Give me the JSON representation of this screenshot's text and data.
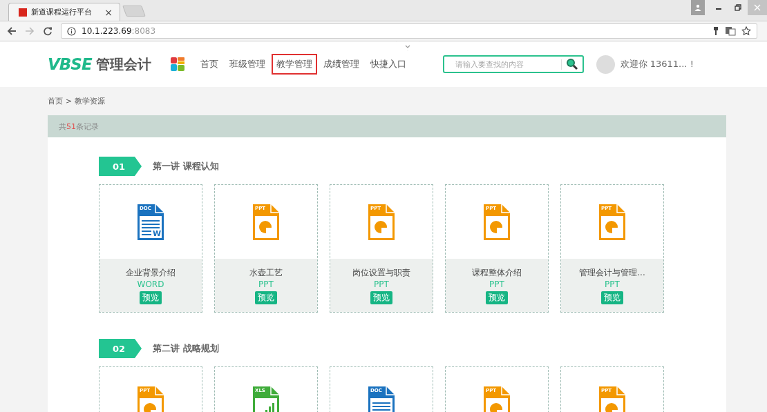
{
  "browser": {
    "tabs": [
      {
        "title": "新道课程运行平台",
        "close": "×",
        "selected": true
      }
    ],
    "address": {
      "host": "10.1.223.69",
      "port": ":8083"
    }
  },
  "header": {
    "logo": {
      "mark": "VBSE",
      "text": "管理会计"
    },
    "nav": [
      {
        "label": "首页",
        "selected": false
      },
      {
        "label": "班级管理",
        "selected": false
      },
      {
        "label": "教学管理",
        "selected": true
      },
      {
        "label": "成绩管理",
        "selected": false
      },
      {
        "label": "快捷入口",
        "selected": false
      }
    ],
    "search": {
      "placeholder": "请输入要查找的内容"
    },
    "user": {
      "greeting": "欢迎你 13611... !"
    }
  },
  "breadcrumb": {
    "home": "首页",
    "separator": ">",
    "current": "教学资源"
  },
  "records": {
    "prefix": "共",
    "count": "51",
    "suffix": "条记录"
  },
  "sections": [
    {
      "number": "01",
      "title": "第一讲 课程认知",
      "files": [
        {
          "kind": "doc",
          "badge": "DOC",
          "mark": "W",
          "name": "企业背景介绍",
          "type": "WORD",
          "action": "预览"
        },
        {
          "kind": "ppt",
          "badge": "PPT",
          "name": "水壶工艺",
          "type": "PPT",
          "action": "预览"
        },
        {
          "kind": "ppt",
          "badge": "PPT",
          "name": "岗位设置与职责",
          "type": "PPT",
          "action": "预览"
        },
        {
          "kind": "ppt",
          "badge": "PPT",
          "name": "课程整体介绍",
          "type": "PPT",
          "action": "预览"
        },
        {
          "kind": "ppt",
          "badge": "PPT",
          "name": "管理会计与管理...",
          "type": "PPT",
          "action": "预览"
        }
      ]
    },
    {
      "number": "02",
      "title": "第二讲 战略规划",
      "files": [
        {
          "kind": "ppt",
          "badge": "PPT"
        },
        {
          "kind": "xls",
          "badge": "XLS"
        },
        {
          "kind": "doc",
          "badge": "DOC"
        },
        {
          "kind": "ppt",
          "badge": "PPT"
        },
        {
          "kind": "ppt",
          "badge": "PPT"
        }
      ]
    }
  ]
}
